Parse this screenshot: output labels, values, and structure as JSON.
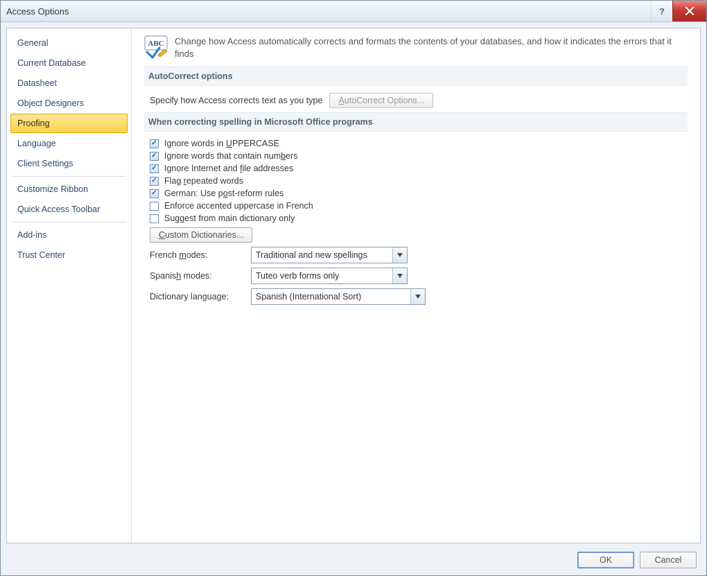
{
  "window": {
    "title": "Access Options"
  },
  "titlebar": {
    "help_glyph": "?",
    "close_glyph": "X"
  },
  "sidebar": {
    "items": [
      {
        "label": "General"
      },
      {
        "label": "Current Database"
      },
      {
        "label": "Datasheet"
      },
      {
        "label": "Object Designers"
      },
      {
        "label": "Proofing",
        "selected": true
      },
      {
        "label": "Language"
      },
      {
        "label": "Client Settings"
      },
      {
        "label": "Customize Ribbon"
      },
      {
        "label": "Quick Access Toolbar"
      },
      {
        "label": "Add-ins"
      },
      {
        "label": "Trust Center"
      }
    ]
  },
  "main": {
    "hero_text": "Change how Access automatically corrects and formats the contents of your databases, and how it indicates the errors that it finds",
    "section_autocorrect": {
      "header": "AutoCorrect options",
      "specify_label": "Specify how Access corrects text as you type",
      "button_label": "AutoCorrect Options..."
    },
    "section_spelling": {
      "header": "When correcting spelling in Microsoft Office programs",
      "checks": [
        {
          "label_pre": "Ignore words in ",
          "u": "U",
          "label_post": "PPERCASE",
          "checked": true
        },
        {
          "label_pre": "Ignore words that contain num",
          "u": "b",
          "label_post": "ers",
          "checked": true
        },
        {
          "label_pre": "Ignore Internet and ",
          "u": "f",
          "label_post": "ile addresses",
          "checked": true
        },
        {
          "label_pre": "Flag ",
          "u": "r",
          "label_post": "epeated words",
          "checked": true
        },
        {
          "label_pre": "German: Use p",
          "u": "o",
          "label_post": "st-reform rules",
          "checked": true
        },
        {
          "label_pre": "Enforce accented uppercase in French",
          "u": "",
          "label_post": "",
          "checked": false
        },
        {
          "label_pre": "Suggest from main dictionary only",
          "u": "",
          "label_post": "",
          "checked": false
        }
      ],
      "custom_dict_btn_pre": "",
      "custom_dict_btn_u": "C",
      "custom_dict_btn_post": "ustom Dictionaries...",
      "french_label_pre": "French ",
      "french_label_u": "m",
      "french_label_post": "odes:",
      "french_value": "Traditional and new spellings",
      "spanish_label_pre": "Spanis",
      "spanish_label_u": "h",
      "spanish_label_post": " modes:",
      "spanish_value": "Tuteo verb forms only",
      "dict_lang_label": "Dictionary language:",
      "dict_lang_value": "Spanish (International Sort)"
    }
  },
  "footer": {
    "ok": "OK",
    "cancel": "Cancel"
  }
}
